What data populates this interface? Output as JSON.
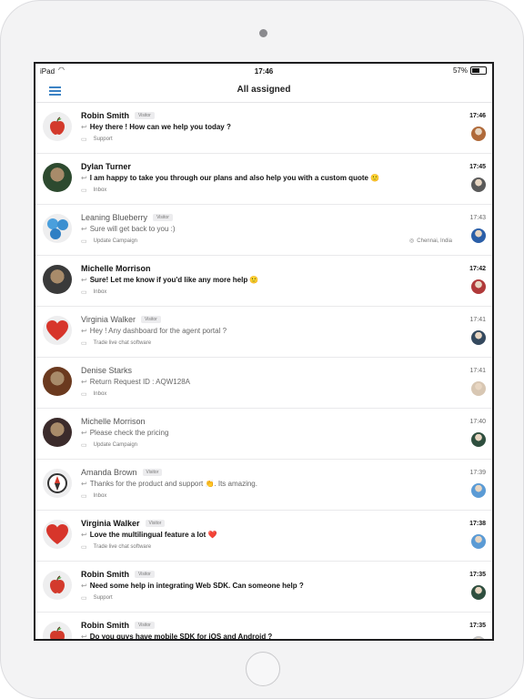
{
  "status_bar": {
    "carrier": "iPad",
    "time": "17:46",
    "battery": "57%"
  },
  "header": {
    "title": "All assigned"
  },
  "conversations": [
    {
      "name": "Robin Smith",
      "visitor_badge": "Visitor",
      "message": "Hey there ! How can we help you today ?",
      "department": "Support",
      "location": "",
      "time": "17:46",
      "unread": true,
      "avatar": "apple-icon",
      "agent_color": "#b06a3a"
    },
    {
      "name": "Dylan Turner",
      "visitor_badge": "",
      "message": "I am happy to take you through our plans and also help you with a custom quote 🙂",
      "department": "Inbox",
      "location": "",
      "time": "17:45",
      "unread": true,
      "avatar": "photo",
      "agent_color": "#5a5a5a"
    },
    {
      "name": "Leaning Blueberry",
      "visitor_badge": "Visitor",
      "message": "Sure will get back to you :)",
      "department": "Update Campaign",
      "location": "Chennai, India",
      "time": "17:43",
      "unread": false,
      "avatar": "blueberry-icon",
      "agent_color": "#2b5fa8"
    },
    {
      "name": "Michelle Morrison",
      "visitor_badge": "",
      "message": "Sure! Let me know if you'd like any more help 🙂",
      "department": "Inbox",
      "location": "",
      "time": "17:42",
      "unread": true,
      "avatar": "photo",
      "agent_color": "#b03a3a"
    },
    {
      "name": "Virginia Walker",
      "visitor_badge": "Visitor",
      "message": "Hey ! Any dashboard for the agent portal ?",
      "department": "Trade live chat software",
      "location": "",
      "time": "17:41",
      "unread": false,
      "avatar": "heart-icon",
      "agent_color": "#34495e"
    },
    {
      "name": "Denise Starks",
      "visitor_badge": "",
      "message": "Return Request ID : AQW128A",
      "department": "Inbox",
      "location": "",
      "time": "17:41",
      "unread": false,
      "avatar": "photo",
      "agent_color": "#d8c7b3"
    },
    {
      "name": "Michelle Morrison",
      "visitor_badge": "",
      "message": "Please check the pricing",
      "department": "Update Campaign",
      "location": "",
      "time": "17:40",
      "unread": false,
      "avatar": "photo",
      "agent_color": "#2f4f3f"
    },
    {
      "name": "Amanda Brown",
      "visitor_badge": "Visitor",
      "message": "Thanks for the product and support 👏. Its amazing.",
      "department": "Inbox",
      "location": "",
      "time": "17:39",
      "unread": false,
      "avatar": "compass-icon",
      "agent_color": "#5b9bd5"
    },
    {
      "name": "Virginia Walker",
      "visitor_badge": "Visitor",
      "message": "Love the multilingual feature a lot ❤️",
      "department": "Trade live chat software",
      "location": "",
      "time": "17:38",
      "unread": true,
      "avatar": "heart-icon",
      "agent_color": "#5b9bd5"
    },
    {
      "name": "Robin Smith",
      "visitor_badge": "Visitor",
      "message": "Need some help in integrating Web SDK. Can someone help ?",
      "department": "Support",
      "location": "",
      "time": "17:35",
      "unread": true,
      "avatar": "apple-icon",
      "agent_color": "#2f4f3f"
    },
    {
      "name": "Robin Smith",
      "visitor_badge": "Visitor",
      "message": "Do you guys have mobile SDK for iOS and Android ?",
      "department": "",
      "location": "",
      "time": "17:35",
      "unread": true,
      "avatar": "apple-icon",
      "agent_color": "#c0c0c0"
    }
  ]
}
